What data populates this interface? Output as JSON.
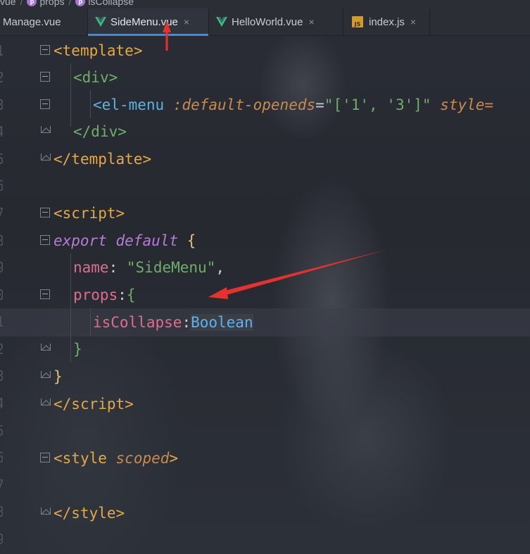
{
  "breadcrumb": {
    "segments": [
      "vue",
      "props",
      "isCollapse"
    ],
    "badge_letter": "p"
  },
  "tabs": [
    {
      "label": "Manage.vue",
      "icon": "none",
      "active": false
    },
    {
      "label": "SideMenu.vue",
      "icon": "vue-icon",
      "active": true
    },
    {
      "label": "HelloWorld.vue",
      "icon": "vue-icon",
      "active": false
    },
    {
      "label": "index.js",
      "icon": "js-icon",
      "active": false
    }
  ],
  "js_badge": "JS",
  "close_glyph": "×",
  "line_numbers": [
    "1",
    "2",
    "3",
    "4",
    "5",
    "6",
    "7",
    "8",
    "9",
    "0",
    "1",
    "2",
    "3",
    "4",
    "5",
    "6",
    "7",
    "8",
    "9",
    "0"
  ],
  "code": {
    "l1": {
      "open": "<",
      "tag": "template",
      "close": ">"
    },
    "l2": {
      "open": "<",
      "tag": "div",
      "close": ">"
    },
    "l3": {
      "open": "<",
      "tag": "el-menu",
      "attr": ":default-openeds",
      "eq": "=",
      "q1": "\"",
      "val": "['1', '3']",
      "q2": "\"",
      "attr2": "style="
    },
    "l4": {
      "open": "</",
      "tag": "div",
      "close": ">"
    },
    "l5": {
      "open": "</",
      "tag": "template",
      "close": ">"
    },
    "l7": {
      "open": "<",
      "tag": "script",
      "close": ">"
    },
    "l8": {
      "kw1": "export",
      "kw2": "default",
      "brace": "{"
    },
    "l9": {
      "key": "name",
      "colon": ":",
      "str": "\"SideMenu\"",
      "comma": ","
    },
    "l10": {
      "key": "props",
      "colon": ":",
      "brace": "{"
    },
    "l11": {
      "key": "isCollapse",
      "colon": ":",
      "type": "Boolean"
    },
    "l12": {
      "brace": "}"
    },
    "l13": {
      "brace": "}"
    },
    "l14": {
      "open": "</",
      "tag": "script",
      "close": ">"
    },
    "l16": {
      "open": "<",
      "tag": "style",
      "attr": "scoped",
      "close": ">"
    },
    "l18": {
      "open": "</",
      "tag": "style",
      "close": ">"
    }
  },
  "colors": {
    "arrow": "#e8302e",
    "accent_tab": "#4a88c7"
  }
}
